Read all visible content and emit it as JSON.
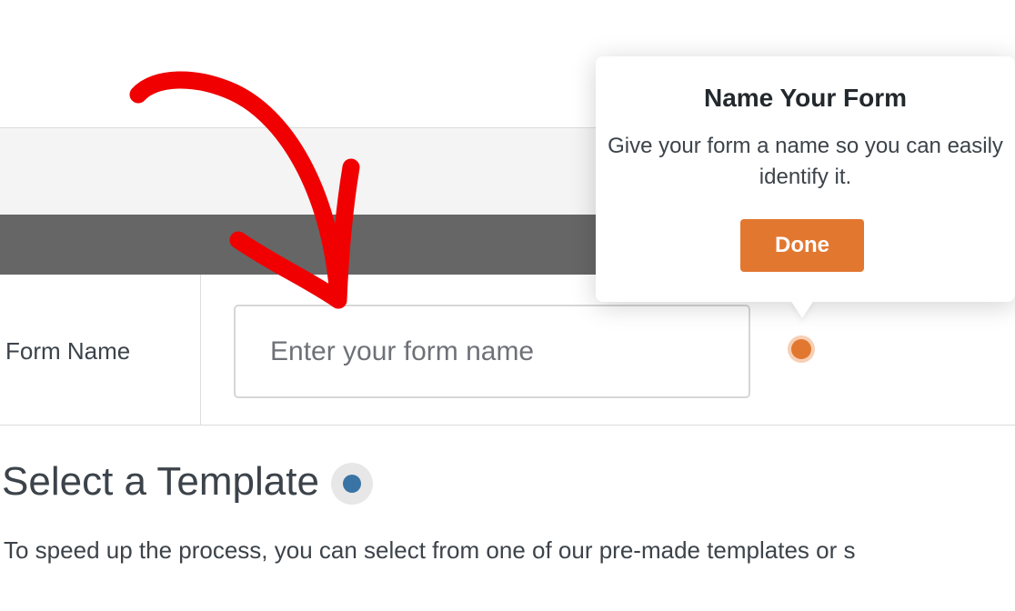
{
  "form_row": {
    "label": "Form Name",
    "input_placeholder": "Enter your form name",
    "input_value": ""
  },
  "tooltip": {
    "title": "Name Your Form",
    "body": "Give your form a name so you can easily identify it.",
    "done_label": "Done"
  },
  "template_section": {
    "title": "Select a Template",
    "description": "To speed up the process, you can select from one of our pre-made templates or s"
  },
  "colors": {
    "accent_orange": "#e27730",
    "help_blue": "#3a74a5",
    "annotation_red": "#f00000",
    "header_dark": "#666666"
  },
  "icons": {
    "annotation": "hand-drawn-arrow",
    "pulse": "pulse-dot",
    "help": "help-dot"
  }
}
